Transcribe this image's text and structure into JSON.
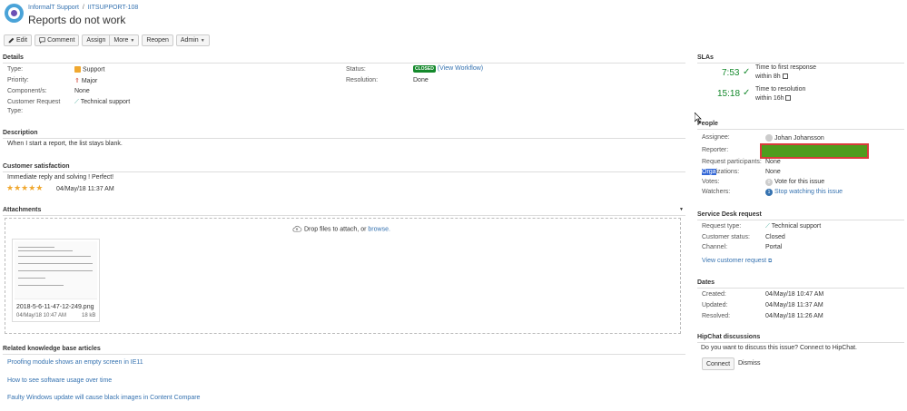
{
  "header": {
    "project": "InformalT Support",
    "separator": "/",
    "issue_key": "IITSUPPORT-108",
    "title": "Reports do not work"
  },
  "toolbar": {
    "edit": "Edit",
    "comment": "Comment",
    "assign": "Assign",
    "more": "More",
    "reopen": "Reopen",
    "admin": "Admin"
  },
  "details": {
    "heading": "Details",
    "type_label": "Type:",
    "type_value": "Support",
    "priority_label": "Priority:",
    "priority_value": "Major",
    "components_label": "Component/s:",
    "components_value": "None",
    "customer_request_label": "Customer Request",
    "customer_request_label2": "Type:",
    "customer_request_value": "Technical support",
    "status_label": "Status:",
    "status_badge": "CLOSED",
    "status_link": "(View Workflow)",
    "resolution_label": "Resolution:",
    "resolution_value": "Done"
  },
  "description": {
    "heading": "Description",
    "text": "When I start a report, the list stays blank."
  },
  "satisfaction": {
    "heading": "Customer satisfaction",
    "comment": "Immediate reply and solving ! Perfect!",
    "rating": 5,
    "date": "04/May/18 11:37 AM"
  },
  "attachments": {
    "heading": "Attachments",
    "drop_text": "Drop files to attach, or",
    "browse": "browse.",
    "file_name": "2018-5-6-11-47-12-249.png",
    "file_date": "04/May/18 10:47 AM",
    "file_size": "18 kB"
  },
  "knowledge": {
    "heading": "Related knowledge base articles",
    "articles": [
      "Proofing module shows an empty screen in IE11",
      "How to see software usage over time",
      "Faulty Windows update will cause black images in Content Compare"
    ]
  },
  "slas": {
    "heading": "SLAs",
    "items": [
      {
        "time": "7:53",
        "name": "Time to first response",
        "goal": "within 8h"
      },
      {
        "time": "15:18",
        "name": "Time to resolution",
        "goal": "within 16h"
      }
    ]
  },
  "people": {
    "heading": "People",
    "assignee_label": "Assignee:",
    "assignee_value": "Johan Johansson",
    "reporter_label": "Reporter:",
    "participants_label": "Request participants:",
    "participants_value": "None",
    "organizations_label_hl": "Orga",
    "organizations_label_rest": "izations:",
    "organizations_value": "None",
    "votes_label": "Votes:",
    "votes_count": "0",
    "votes_link": "Vote for this issue",
    "watchers_label": "Watchers:",
    "watchers_count": "1",
    "watchers_link": "Stop watching this issue"
  },
  "service_desk": {
    "heading": "Service Desk request",
    "request_type_label": "Request type:",
    "request_type_value": "Technical support",
    "customer_status_label": "Customer status:",
    "customer_status_value": "Closed",
    "channel_label": "Channel:",
    "channel_value": "Portal",
    "view_link": "View customer request"
  },
  "dates": {
    "heading": "Dates",
    "created_label": "Created:",
    "created_value": "04/May/18 10:47 AM",
    "updated_label": "Updated:",
    "updated_value": "04/May/18 11:37 AM",
    "resolved_label": "Resolved:",
    "resolved_value": "04/May/18 11:26 AM"
  },
  "hipchat": {
    "heading": "HipChat discussions",
    "text": "Do you want to discuss this issue? Connect to HipChat.",
    "connect": "Connect",
    "dismiss": "Dismiss"
  },
  "colors": {
    "link": "#3572b0",
    "closed": "#14892c",
    "sla_green": "#14892c",
    "reporter_redacted": "#4f9c1d",
    "reporter_border": "#d93b3b"
  }
}
